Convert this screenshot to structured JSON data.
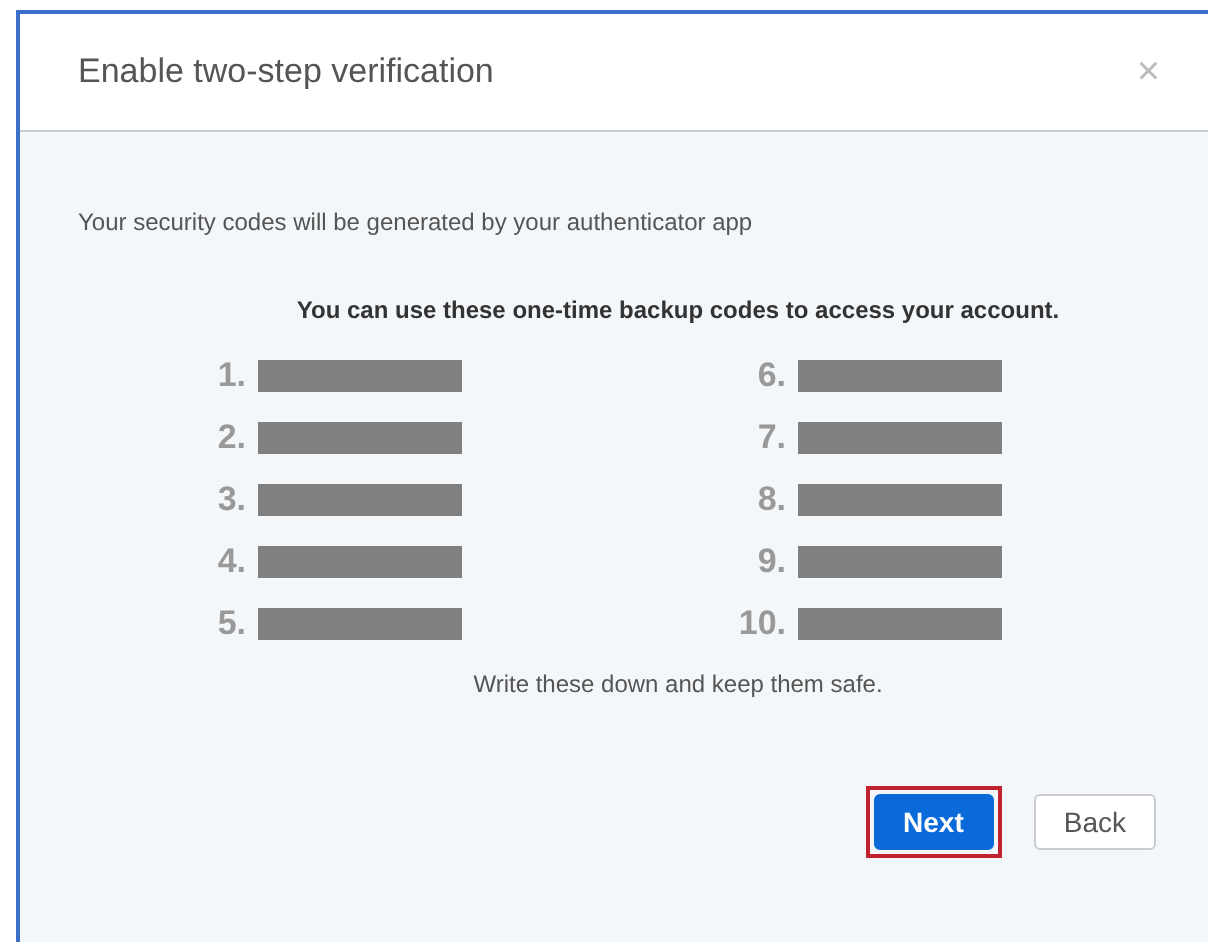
{
  "dialog": {
    "title": "Enable two-step verification",
    "close": "×"
  },
  "intro": "Your security codes will be generated by your authenticator app",
  "codes_heading": "You can use these one-time backup codes to access your account.",
  "codes": [
    {
      "number": "1."
    },
    {
      "number": "2."
    },
    {
      "number": "3."
    },
    {
      "number": "4."
    },
    {
      "number": "5."
    },
    {
      "number": "6."
    },
    {
      "number": "7."
    },
    {
      "number": "8."
    },
    {
      "number": "9."
    },
    {
      "number": "10."
    }
  ],
  "note": "Write these down and keep them safe.",
  "buttons": [
    {
      "label": "Next",
      "kind": "primary",
      "highlighted": true
    },
    {
      "label": "Back",
      "kind": "secondary",
      "highlighted": false
    }
  ]
}
